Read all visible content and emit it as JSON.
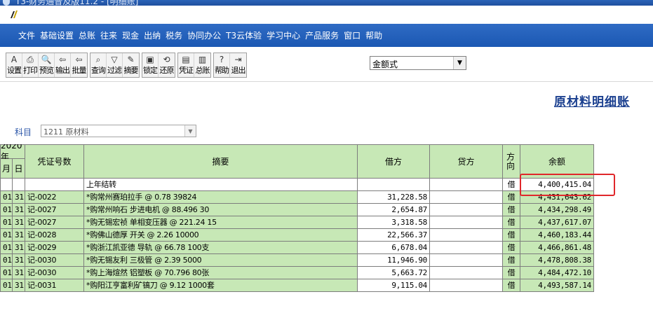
{
  "window": {
    "title": "T3-财务通普及版11.2 - [明细账]"
  },
  "menu": [
    "文件",
    "基础设置",
    "总账",
    "往来",
    "现金",
    "出纳",
    "税务",
    "协同办公",
    "T3云体验",
    "学习中心",
    "产品服务",
    "窗口",
    "帮助"
  ],
  "toolbar": {
    "groups": [
      [
        {
          "icon": "settings-icon",
          "glyph": "A",
          "label": "设置"
        },
        {
          "icon": "print-icon",
          "glyph": "⎙",
          "label": "打印"
        },
        {
          "icon": "preview-icon",
          "glyph": "🔍",
          "label": "预览"
        },
        {
          "icon": "export-icon",
          "glyph": "⇦",
          "label": "输出"
        },
        {
          "icon": "batch-icon",
          "glyph": "⇦",
          "label": "批量"
        }
      ],
      [
        {
          "icon": "query-icon",
          "glyph": "⌕",
          "label": "查询"
        },
        {
          "icon": "filter-icon",
          "glyph": "▽",
          "label": "过滤"
        },
        {
          "icon": "summary-icon",
          "glyph": "✎",
          "label": "摘要"
        }
      ],
      [
        {
          "icon": "lock-icon",
          "glyph": "▣",
          "label": "锁定"
        },
        {
          "icon": "restore-icon",
          "glyph": "⟲",
          "label": "还原"
        }
      ],
      [
        {
          "icon": "voucher-icon",
          "glyph": "▤",
          "label": "凭证"
        },
        {
          "icon": "ledger-icon",
          "glyph": "▥",
          "label": "总账"
        }
      ],
      [
        {
          "icon": "help-icon",
          "glyph": "?",
          "label": "帮助"
        },
        {
          "icon": "exit-icon",
          "glyph": "⇥",
          "label": "退出"
        }
      ]
    ],
    "format_select": "金额式"
  },
  "report": {
    "title": "原材料明细账"
  },
  "subject": {
    "label": "科目",
    "value": "1211 原材料"
  },
  "table": {
    "year": "2020年",
    "headers": {
      "month": "月",
      "day": "日",
      "voucher": "凭证号数",
      "summary": "摘要",
      "debit": "借方",
      "credit": "贷方",
      "direction": "方向",
      "balance": "余额"
    },
    "rows": [
      {
        "month": "",
        "day": "",
        "voucher": "",
        "summary": "上年结转",
        "debit": "",
        "credit": "",
        "direction": "借",
        "balance": "4,400,415.04"
      },
      {
        "month": "01",
        "day": "31",
        "voucher": "记-0022",
        "summary": "*购常州赛珀拉手 @ 0.78 39824",
        "debit": "31,228.58",
        "credit": "",
        "direction": "借",
        "balance": "4,431,643.62"
      },
      {
        "month": "01",
        "day": "31",
        "voucher": "记-0027",
        "summary": "*购常州响石 步进电机 @ 88.496 30",
        "debit": "2,654.87",
        "credit": "",
        "direction": "借",
        "balance": "4,434,298.49"
      },
      {
        "month": "01",
        "day": "31",
        "voucher": "记-0027",
        "summary": "*购无锡宏祯 单相变压器 @ 221.24 15",
        "debit": "3,318.58",
        "credit": "",
        "direction": "借",
        "balance": "4,437,617.07"
      },
      {
        "month": "01",
        "day": "31",
        "voucher": "记-0028",
        "summary": "*购佛山德厚 开关 @ 2.26 10000",
        "debit": "22,566.37",
        "credit": "",
        "direction": "借",
        "balance": "4,460,183.44"
      },
      {
        "month": "01",
        "day": "31",
        "voucher": "记-0029",
        "summary": "*购浙江凯亚德 导轨 @ 66.78 100支",
        "debit": "6,678.04",
        "credit": "",
        "direction": "借",
        "balance": "4,466,861.48"
      },
      {
        "month": "01",
        "day": "31",
        "voucher": "记-0030",
        "summary": "*购无锡友利 三极管 @ 2.39 5000",
        "debit": "11,946.90",
        "credit": "",
        "direction": "借",
        "balance": "4,478,808.38"
      },
      {
        "month": "01",
        "day": "31",
        "voucher": "记-0030",
        "summary": "*购上海煊然 铝塑板 @ 70.796 80张",
        "debit": "5,663.72",
        "credit": "",
        "direction": "借",
        "balance": "4,484,472.10"
      },
      {
        "month": "01",
        "day": "31",
        "voucher": "记-0031",
        "summary": "*购阳江亨富利矿镐刀 @ 9.12 1000套",
        "debit": "9,115.04",
        "credit": "",
        "direction": "借",
        "balance": "4,493,587.14"
      }
    ]
  }
}
